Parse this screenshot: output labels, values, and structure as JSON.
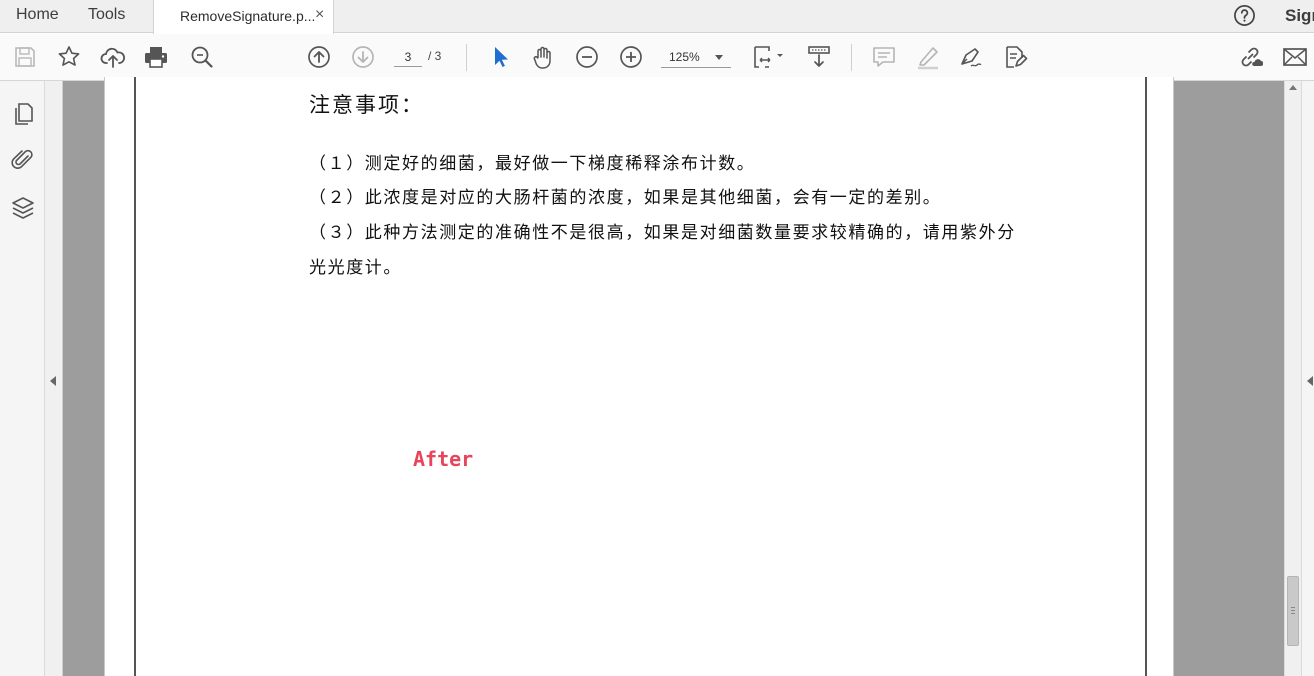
{
  "tabs": {
    "home_label": "Home",
    "tools_label": "Tools",
    "document_tab_label": "RemoveSignature.p...",
    "close_symbol": "×",
    "sign_label": "Sign"
  },
  "toolbar": {
    "current_page": "3",
    "total_pages": "/ 3",
    "zoom": "125%",
    "icons": [
      "save-icon",
      "bookmark-star-icon",
      "cloud-upload-icon",
      "print-icon",
      "search-zoom-icon",
      "previous-page-icon",
      "next-page-icon",
      "select-cursor-icon",
      "hand-tool-icon",
      "zoom-out-icon",
      "zoom-in-icon",
      "page-fit-icon",
      "scroll-mode-icon",
      "comment-icon",
      "highlight-icon",
      "sign-pen-icon",
      "fill-sign-icon",
      "share-link-icon",
      "email-icon"
    ]
  },
  "left_rail": {
    "icons": [
      "page-thumbnails-icon",
      "attachments-icon",
      "layers-icon"
    ]
  },
  "document": {
    "heading": "注意事项：",
    "lines": [
      "（１）测定好的细菌，最好做一下梯度稀释涂布计数。",
      "（２）此浓度是对应的大肠杆菌的浓度，如果是其他细菌，会有一定的差别。",
      "（３）此种方法测定的准确性不是很高，如果是对细菌数量要求较精确的，请用紫外分",
      "光光度计。"
    ],
    "watermark_label": "After",
    "watermark_color": "#e8445a"
  },
  "colors": {
    "canvas_gray": "#9d9d9d",
    "selected_tool_blue": "#1f6fd1"
  }
}
